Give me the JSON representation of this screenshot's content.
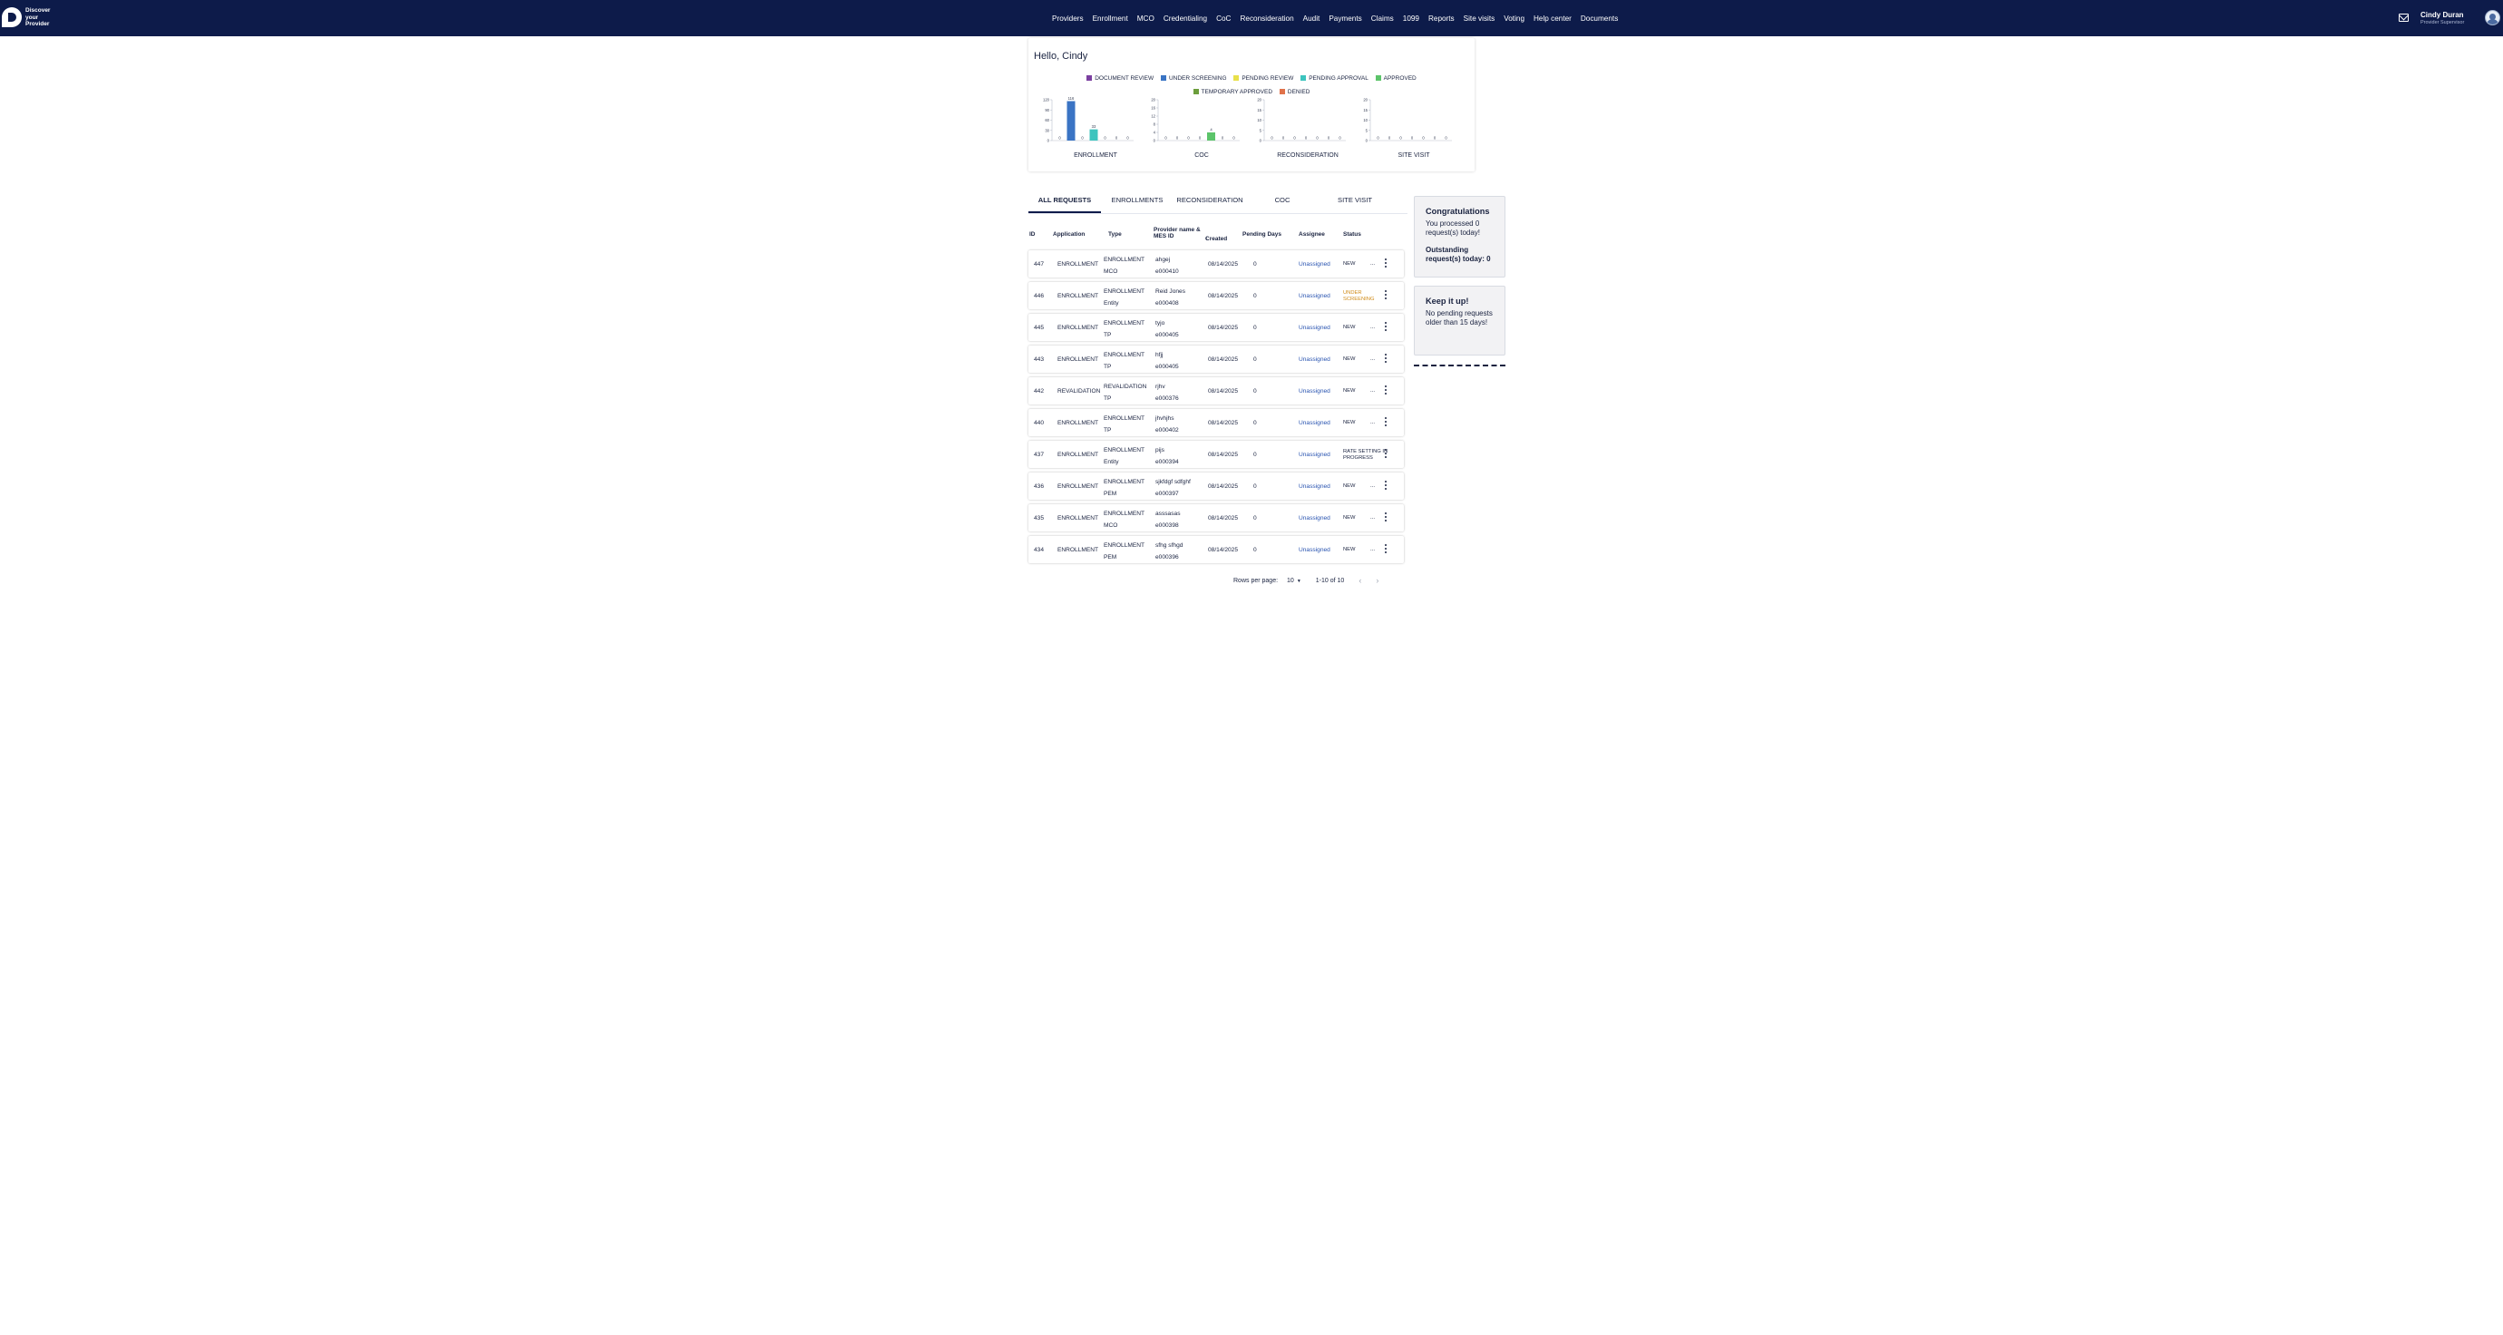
{
  "app": {
    "logo_text": [
      "Discover",
      "your",
      "Provider"
    ],
    "nav": [
      "Providers",
      "Enrollment",
      "MCO",
      "Credentialing",
      "CoC",
      "Reconsideration",
      "Audit",
      "Payments",
      "Claims",
      "1099",
      "Reports",
      "Site visits",
      "Voting",
      "Help center",
      "Documents"
    ],
    "user_name": "Cindy Duran",
    "user_role": "Provider Supervisor"
  },
  "greeting": "Hello, Cindy",
  "legend": [
    {
      "label": "DOCUMENT REVIEW",
      "color": "#7b3fa0"
    },
    {
      "label": "UNDER SCREENING",
      "color": "#3a74c4"
    },
    {
      "label": "PENDING REVIEW",
      "color": "#e8e04a"
    },
    {
      "label": "PENDING APPROVAL",
      "color": "#3cc4be"
    },
    {
      "label": "APPROVED",
      "color": "#5cc46a"
    },
    {
      "label": "TEMPORARY APPROVED",
      "color": "#6c9e3c"
    },
    {
      "label": "DENIED",
      "color": "#e0724a"
    }
  ],
  "chart_data": [
    {
      "type": "bar",
      "title": "ENROLLMENT",
      "categories": [
        "DOCUMENT REVIEW",
        "UNDER SCREENING",
        "PENDING REVIEW",
        "PENDING APPROVAL",
        "APPROVED",
        "TEMPORARY APPROVED",
        "DENIED"
      ],
      "values": [
        0,
        116,
        0,
        33,
        0,
        0,
        0
      ],
      "ylim": [
        0,
        120
      ],
      "yticks": [
        0,
        30,
        60,
        90,
        120
      ]
    },
    {
      "type": "bar",
      "title": "COC",
      "categories": [
        "DOCUMENT REVIEW",
        "UNDER SCREENING",
        "PENDING REVIEW",
        "PENDING APPROVAL",
        "APPROVED",
        "TEMPORARY APPROVED",
        "DENIED"
      ],
      "values": [
        0,
        0,
        0,
        0,
        4,
        0,
        0
      ],
      "ylim": [
        0,
        20
      ],
      "yticks": [
        0,
        4,
        8,
        12,
        16,
        20
      ]
    },
    {
      "type": "bar",
      "title": "RECONSIDERATION",
      "categories": [
        "DOCUMENT REVIEW",
        "UNDER SCREENING",
        "PENDING REVIEW",
        "PENDING APPROVAL",
        "APPROVED",
        "TEMPORARY APPROVED",
        "DENIED"
      ],
      "values": [
        0,
        0,
        0,
        0,
        0,
        0,
        0
      ],
      "ylim": [
        0,
        20
      ],
      "yticks": [
        0,
        5,
        10,
        15,
        20
      ]
    },
    {
      "type": "bar",
      "title": "SITE VISIT",
      "categories": [
        "DOCUMENT REVIEW",
        "UNDER SCREENING",
        "PENDING REVIEW",
        "PENDING APPROVAL",
        "APPROVED",
        "TEMPORARY APPROVED",
        "DENIED"
      ],
      "values": [
        0,
        0,
        0,
        0,
        0,
        0,
        0
      ],
      "ylim": [
        0,
        20
      ],
      "yticks": [
        0,
        5,
        10,
        15,
        20
      ]
    }
  ],
  "tabs": [
    "ALL REQUESTS",
    "ENROLLMENTS",
    "RECONSIDERATION",
    "COC",
    "SITE VISIT"
  ],
  "columns": {
    "id": "ID",
    "application": "Application",
    "type": "Type",
    "provider": "Provider name & MES ID",
    "created": "Created",
    "created_sort": "↓",
    "pending": "Pending Days",
    "assignee": "Assignee",
    "status": "Status"
  },
  "rows": [
    {
      "id": "447",
      "application": "ENROLLMENT",
      "type": [
        "ENROLLMENT",
        "MCO"
      ],
      "provider": [
        "ahgej",
        "e000410"
      ],
      "created": "08/14/2025",
      "pending": "0",
      "assignee": "Unassigned",
      "status": [
        "NEW"
      ],
      "status_warn": false
    },
    {
      "id": "446",
      "application": "ENROLLMENT",
      "type": [
        "ENROLLMENT",
        "Entity"
      ],
      "provider": [
        "Reid Jones",
        "e000408"
      ],
      "created": "08/14/2025",
      "pending": "0",
      "assignee": "Unassigned",
      "status": [
        "UNDER",
        "SCREENING"
      ],
      "status_warn": true
    },
    {
      "id": "445",
      "application": "ENROLLMENT",
      "type": [
        "ENROLLMENT",
        "TP"
      ],
      "provider": [
        "tyjo",
        "e000405"
      ],
      "created": "08/14/2025",
      "pending": "0",
      "assignee": "Unassigned",
      "status": [
        "NEW"
      ],
      "status_warn": false
    },
    {
      "id": "443",
      "application": "ENROLLMENT",
      "type": [
        "ENROLLMENT",
        "TP"
      ],
      "provider": [
        "hfjj",
        "e000405"
      ],
      "created": "08/14/2025",
      "pending": "0",
      "assignee": "Unassigned",
      "status": [
        "NEW"
      ],
      "status_warn": false
    },
    {
      "id": "442",
      "application": "REVALIDATION",
      "type": [
        "REVALIDATION",
        "TP"
      ],
      "provider": [
        "rjhv",
        "e000376"
      ],
      "created": "08/14/2025",
      "pending": "0",
      "assignee": "Unassigned",
      "status": [
        "NEW"
      ],
      "status_warn": false
    },
    {
      "id": "440",
      "application": "ENROLLMENT",
      "type": [
        "ENROLLMENT",
        "TP"
      ],
      "provider": [
        "jhvhjhs",
        "e000402"
      ],
      "created": "08/14/2025",
      "pending": "0",
      "assignee": "Unassigned",
      "status": [
        "NEW"
      ],
      "status_warn": false
    },
    {
      "id": "437",
      "application": "ENROLLMENT",
      "type": [
        "ENROLLMENT",
        "Entity"
      ],
      "provider": [
        "pijs",
        "e000394"
      ],
      "created": "08/14/2025",
      "pending": "0",
      "assignee": "Unassigned",
      "status": [
        "RATE SETTING IN",
        "PROGRESS"
      ],
      "status_warn": false
    },
    {
      "id": "436",
      "application": "ENROLLMENT",
      "type": [
        "ENROLLMENT",
        "PEM"
      ],
      "provider": [
        "sjkfdgf sdfghf",
        "e000397"
      ],
      "created": "08/14/2025",
      "pending": "0",
      "assignee": "Unassigned",
      "status": [
        "NEW"
      ],
      "status_warn": false
    },
    {
      "id": "435",
      "application": "ENROLLMENT",
      "type": [
        "ENROLLMENT",
        "MCO"
      ],
      "provider": [
        "asssasas",
        "e000398"
      ],
      "created": "08/14/2025",
      "pending": "0",
      "assignee": "Unassigned",
      "status": [
        "NEW"
      ],
      "status_warn": false
    },
    {
      "id": "434",
      "application": "ENROLLMENT",
      "type": [
        "ENROLLMENT",
        "PEM"
      ],
      "provider": [
        "sfhg sfhgd",
        "e000396"
      ],
      "created": "08/14/2025",
      "pending": "0",
      "assignee": "Unassigned",
      "status": [
        "NEW"
      ],
      "status_warn": false
    }
  ],
  "pagination": {
    "rows_per_page_label": "Rows per page:",
    "rows_per_page": "10",
    "range": "1-10 of 10"
  },
  "side": {
    "congrats_title": "Congratulations",
    "congrats_text": "You processed 0 request(s) today!",
    "outstanding": "Outstanding request(s) today: 0",
    "keep_title": "Keep it up!",
    "keep_text": "No pending requests older than 15 days!"
  }
}
